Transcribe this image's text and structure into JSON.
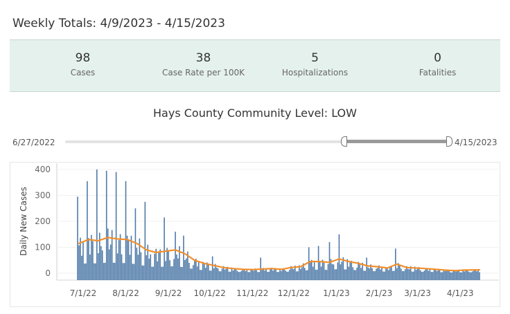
{
  "header": {
    "title": "Weekly Totals: 4/9/2023 - 4/15/2023"
  },
  "stats": [
    {
      "value": "98",
      "label": "Cases"
    },
    {
      "value": "38",
      "label": "Case Rate per 100K"
    },
    {
      "value": "5",
      "label": "Hospitalizations"
    },
    {
      "value": "0",
      "label": "Fatalities"
    }
  ],
  "level_title": "Hays County Community Level: LOW",
  "date_slider": {
    "start_label": "6/27/2022",
    "end_label": "4/15/2023"
  },
  "colors": {
    "bars": "#4e79a7",
    "average": "#f28e2b",
    "panel": "#e5f1ec"
  },
  "chart_data": {
    "type": "bar",
    "ylabel": "Daily New Cases",
    "xlabel": "",
    "ylim": [
      0,
      400
    ],
    "y_ticks": [
      "0",
      "100",
      "200",
      "300",
      "400"
    ],
    "x_tick_labels": [
      "7/1/22",
      "8/1/22",
      "9/1/22",
      "10/1/22",
      "11/1/22",
      "12/1/22",
      "1/1/23",
      "2/1/23",
      "3/1/23",
      "4/1/23"
    ],
    "series": [
      {
        "type": "bar",
        "peaks": [
          {
            "x": "6/27/22",
            "y": 295
          },
          {
            "x": "7/4/22",
            "y": 355
          },
          {
            "x": "7/11/22",
            "y": 400
          },
          {
            "x": "7/18/22",
            "y": 395
          },
          {
            "x": "7/25/22",
            "y": 390
          },
          {
            "x": "8/1/22",
            "y": 355
          },
          {
            "x": "8/8/22",
            "y": 250
          },
          {
            "x": "8/15/22",
            "y": 275
          },
          {
            "x": "8/29/22",
            "y": 215
          },
          {
            "x": "9/6/22",
            "y": 160
          },
          {
            "x": "9/12/22",
            "y": 145
          },
          {
            "x": "10/3/22",
            "y": 65
          },
          {
            "x": "11/7/22",
            "y": 60
          },
          {
            "x": "12/12/22",
            "y": 100
          },
          {
            "x": "12/19/22",
            "y": 105
          },
          {
            "x": "12/27/22",
            "y": 120
          },
          {
            "x": "1/3/23",
            "y": 150
          },
          {
            "x": "1/23/23",
            "y": 60
          },
          {
            "x": "2/13/23",
            "y": 95
          }
        ]
      },
      {
        "type": "line",
        "points": [
          {
            "x": "6/28/22",
            "y": 115
          },
          {
            "x": "7/5/22",
            "y": 130
          },
          {
            "x": "7/12/22",
            "y": 125
          },
          {
            "x": "7/19/22",
            "y": 138
          },
          {
            "x": "7/26/22",
            "y": 132
          },
          {
            "x": "8/2/22",
            "y": 130
          },
          {
            "x": "8/9/22",
            "y": 115
          },
          {
            "x": "8/16/22",
            "y": 90
          },
          {
            "x": "8/23/22",
            "y": 80
          },
          {
            "x": "8/30/22",
            "y": 85
          },
          {
            "x": "9/6/22",
            "y": 90
          },
          {
            "x": "9/13/22",
            "y": 75
          },
          {
            "x": "9/20/22",
            "y": 50
          },
          {
            "x": "9/27/22",
            "y": 38
          },
          {
            "x": "10/4/22",
            "y": 30
          },
          {
            "x": "10/11/22",
            "y": 22
          },
          {
            "x": "10/18/22",
            "y": 18
          },
          {
            "x": "10/25/22",
            "y": 15
          },
          {
            "x": "11/1/22",
            "y": 14
          },
          {
            "x": "11/8/22",
            "y": 16
          },
          {
            "x": "11/15/22",
            "y": 18
          },
          {
            "x": "11/22/22",
            "y": 15
          },
          {
            "x": "11/29/22",
            "y": 22
          },
          {
            "x": "12/6/22",
            "y": 25
          },
          {
            "x": "12/13/22",
            "y": 45
          },
          {
            "x": "12/20/22",
            "y": 45
          },
          {
            "x": "12/27/22",
            "y": 42
          },
          {
            "x": "1/3/23",
            "y": 55
          },
          {
            "x": "1/10/23",
            "y": 45
          },
          {
            "x": "1/17/23",
            "y": 38
          },
          {
            "x": "1/24/23",
            "y": 28
          },
          {
            "x": "1/31/23",
            "y": 25
          },
          {
            "x": "2/7/23",
            "y": 20
          },
          {
            "x": "2/14/23",
            "y": 35
          },
          {
            "x": "2/21/23",
            "y": 22
          },
          {
            "x": "2/28/23",
            "y": 20
          },
          {
            "x": "3/7/23",
            "y": 18
          },
          {
            "x": "3/14/23",
            "y": 15
          },
          {
            "x": "3/21/23",
            "y": 12
          },
          {
            "x": "3/28/23",
            "y": 10
          },
          {
            "x": "4/4/23",
            "y": 12
          },
          {
            "x": "4/15/23",
            "y": 13
          }
        ]
      }
    ]
  }
}
